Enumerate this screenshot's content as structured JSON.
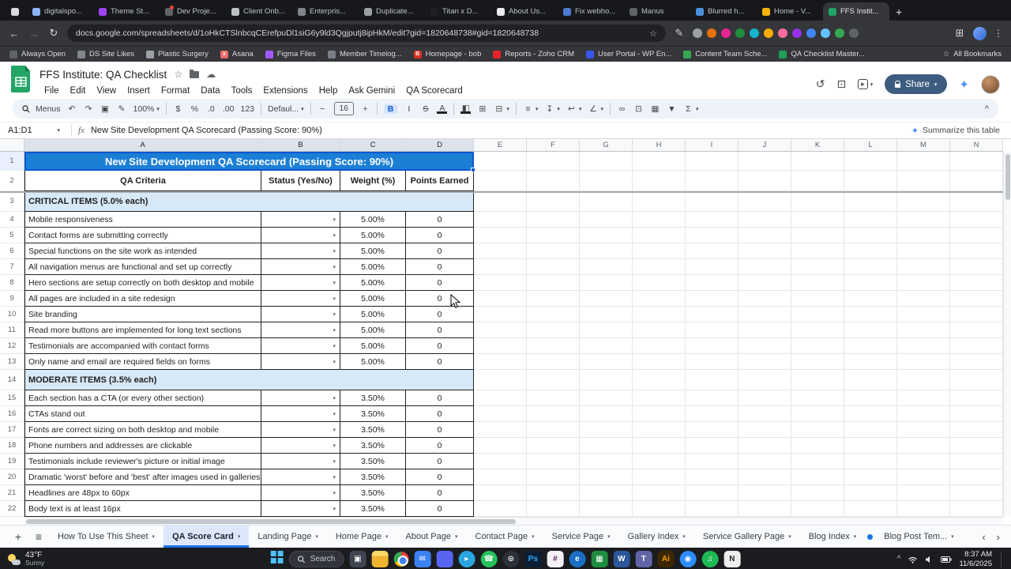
{
  "browser": {
    "tab_strip": {
      "new_tab_label": "+",
      "tabs": [
        {
          "label": "",
          "favicon_color": "#d8dade",
          "pinned": true
        },
        {
          "label": "digitalspo...",
          "favicon_color": "#8ab4f8"
        },
        {
          "label": "Theme St...",
          "favicon_color": "#a142f4"
        },
        {
          "label": "Dev Proje...",
          "favicon_color": "#5f6368",
          "notification": true
        },
        {
          "label": "Client Onb...",
          "favicon_color": "#bdc1c6"
        },
        {
          "label": "Enterpris...",
          "favicon_color": "#80868b"
        },
        {
          "label": "Duplicate...",
          "favicon_color": "#9aa0a6"
        },
        {
          "label": "Titan x D...",
          "favicon_color": "#202124"
        },
        {
          "label": "About Us...",
          "favicon_color": "#e8eaed"
        },
        {
          "label": "Fix webho...",
          "favicon_color": "#4a7bd0"
        },
        {
          "label": "Manus",
          "favicon_color": "#5f6368"
        },
        {
          "label": "Blurred h...",
          "favicon_color": "#4a90d9"
        },
        {
          "label": "Home - V...",
          "favicon_color": "#f4b400"
        },
        {
          "label": "FFS Instit...",
          "favicon_color": "#21a464",
          "active": true
        }
      ]
    },
    "omnibox": {
      "url": "docs.google.com/spreadsheets/d/1oHkCTSlnbcqCErefpuDl1siG6y9ld3Qgjputj8ipHkM/edit?gid=1820648738#gid=1820648738",
      "extension_colors": [
        "#9aa0a6",
        "#e8710a",
        "#e52592",
        "#1e8e3e",
        "#12b5cb",
        "#f9ab00",
        "#ff6d9d",
        "#9334e6",
        "#4285f4",
        "#66c2ff",
        "#34a853",
        "#5f6368"
      ]
    },
    "bookmarks_bar": {
      "items": [
        {
          "label": "Always Open",
          "favicon_color": "#5f6368"
        },
        {
          "label": "DS Site Likes",
          "favicon_color": "#80868b"
        },
        {
          "label": "Plastic Surgery",
          "favicon_color": "#9aa0a6"
        },
        {
          "label": "Asana",
          "favicon_color": "#f06a6a",
          "badge": "x"
        },
        {
          "label": "Figma Files",
          "favicon_color": "#a259ff"
        },
        {
          "label": "Member Timelog...",
          "favicon_color": "#7a7f85"
        },
        {
          "label": "Homepage - bob",
          "favicon_color": "#d93025",
          "favicon_letter": "B"
        },
        {
          "label": "Reports - Zoho CRM",
          "favicon_color": "#e42527"
        },
        {
          "label": "User Portal - WP En...",
          "favicon_color": "#3858e9"
        },
        {
          "label": "Content Team Sche...",
          "favicon_color": "#34a853"
        },
        {
          "label": "QA Checklist Master...",
          "favicon_color": "#1e9e5a"
        }
      ],
      "all_bookmarks_label": "All Bookmarks"
    }
  },
  "sheets": {
    "doc_title": "FFS Institute: QA Checklist",
    "title_icons": [
      {
        "name": "star-icon",
        "glyph": "☆"
      },
      {
        "name": "move-to-folder-icon",
        "glyph": ""
      },
      {
        "name": "cloud-save-status-icon",
        "glyph": "☁"
      }
    ],
    "menu_items": [
      "File",
      "Edit",
      "View",
      "Insert",
      "Format",
      "Data",
      "Tools",
      "Extensions",
      "Help",
      "Ask Gemini",
      "QA Scorecard"
    ],
    "header_icons": [
      {
        "name": "version-history-icon",
        "glyph": "↺"
      },
      {
        "name": "comments-icon",
        "glyph": "⊡"
      },
      {
        "name": "meet-icon",
        "glyph": "▸",
        "dropdown": true
      }
    ],
    "share_label": "Share",
    "toolbar_items": [
      {
        "type": "menus",
        "name": "menus-button",
        "label": "Menus"
      },
      {
        "type": "icon",
        "name": "undo-icon",
        "glyph": "↶"
      },
      {
        "type": "icon",
        "name": "redo-icon",
        "glyph": "↷"
      },
      {
        "type": "icon",
        "name": "print-icon",
        "glyph": "▣"
      },
      {
        "type": "icon",
        "name": "paint-format-icon",
        "glyph": "✎"
      },
      {
        "type": "dropdown",
        "name": "zoom-select",
        "label": "100%"
      },
      {
        "type": "sep"
      },
      {
        "type": "icon",
        "name": "format-currency-icon",
        "glyph": "$"
      },
      {
        "type": "icon",
        "name": "format-percent-icon",
        "glyph": "%"
      },
      {
        "type": "icon",
        "name": "decrease-decimal-icon",
        "glyph": ".0"
      },
      {
        "type": "icon",
        "name": "increase-decimal-icon",
        "glyph": ".00"
      },
      {
        "type": "icon",
        "name": "more-formats-icon",
        "glyph": "123"
      },
      {
        "type": "sep"
      },
      {
        "type": "dropdown",
        "name": "font-family-select",
        "label": "Defaul..."
      },
      {
        "type": "sep"
      },
      {
        "type": "icon",
        "name": "decrease-font-size-icon",
        "glyph": "−"
      },
      {
        "type": "value",
        "name": "font-size-input",
        "label": "16"
      },
      {
        "type": "icon",
        "name": "increase-font-size-icon",
        "glyph": "+"
      },
      {
        "type": "sep"
      },
      {
        "type": "icon",
        "name": "bold-icon",
        "glyph": "B",
        "active": true
      },
      {
        "type": "icon",
        "name": "italic-icon",
        "glyph": "I"
      },
      {
        "type": "icon",
        "name": "strikethrough-icon",
        "glyph": "S",
        "strike": true
      },
      {
        "type": "icon",
        "name": "text-color-icon",
        "glyph": "A",
        "underbar": true
      },
      {
        "type": "sep"
      },
      {
        "type": "icon",
        "name": "fill-color-icon",
        "glyph": "◧",
        "underbar": true
      },
      {
        "type": "icon",
        "name": "borders-icon",
        "glyph": "⊞"
      },
      {
        "type": "icon",
        "name": "merge-cells-icon",
        "glyph": "⊟",
        "dropdown": true
      },
      {
        "type": "sep"
      },
      {
        "type": "icon",
        "name": "horizontal-align-icon",
        "glyph": "≡",
        "dropdown": true
      },
      {
        "type": "icon",
        "name": "vertical-align-icon",
        "glyph": "↧",
        "dropdown": true
      },
      {
        "type": "icon",
        "name": "text-wrap-icon",
        "glyph": "↩",
        "dropdown": true
      },
      {
        "type": "icon",
        "name": "text-rotation-icon",
        "glyph": "∠",
        "dropdown": true
      },
      {
        "type": "sep"
      },
      {
        "type": "icon",
        "name": "insert-link-icon",
        "glyph": "∞"
      },
      {
        "type": "icon",
        "name": "insert-comment-icon",
        "glyph": "⊡"
      },
      {
        "type": "icon",
        "name": "insert-chart-icon",
        "glyph": "▦"
      },
      {
        "type": "icon",
        "name": "create-filter-icon",
        "glyph": "▼"
      },
      {
        "type": "icon",
        "name": "functions-icon",
        "glyph": "Σ",
        "dropdown": true
      }
    ],
    "toolbar_collapse_glyph": "^",
    "name_box_value": "A1:D1",
    "fx_label": "fx",
    "formula_text": "New Site Development QA Scorecard (Passing Score: 90%)",
    "summarize_label": "Summarize this table"
  },
  "grid": {
    "column_letters": [
      "A",
      "B",
      "C",
      "D",
      "E",
      "F",
      "G",
      "H",
      "I",
      "J",
      "K",
      "L",
      "M",
      "N"
    ],
    "selected_columns": [
      "A",
      "B",
      "C",
      "D"
    ],
    "selected_row_number": 1,
    "rows": [
      {
        "n": 1,
        "type": "title",
        "text": "New Site Development QA Scorecard (Passing Score: 90%)"
      },
      {
        "n": 2,
        "type": "header",
        "cells": [
          "QA Criteria",
          "Status (Yes/No)",
          "Weight (%)",
          "Points Earned"
        ]
      },
      {
        "n": 3,
        "type": "section",
        "text": "CRITICAL ITEMS (5.0% each)"
      },
      {
        "n": 4,
        "type": "item",
        "criteria": "Mobile responsiveness",
        "weight": "5.00%",
        "points": "0"
      },
      {
        "n": 5,
        "type": "item",
        "criteria": "Contact forms are submitting correctly",
        "weight": "5.00%",
        "points": "0"
      },
      {
        "n": 6,
        "type": "item",
        "criteria": "Special functions on the site work as intended",
        "weight": "5.00%",
        "points": "0"
      },
      {
        "n": 7,
        "type": "item",
        "criteria": "All navigation menus are functional and set up correctly",
        "weight": "5.00%",
        "points": "0"
      },
      {
        "n": 8,
        "type": "item",
        "criteria": "Hero sections are setup correctly on both desktop and mobile",
        "weight": "5.00%",
        "points": "0"
      },
      {
        "n": 9,
        "type": "item",
        "criteria": "All pages are included in a site redesign",
        "weight": "5.00%",
        "points": "0"
      },
      {
        "n": 10,
        "type": "item",
        "criteria": "Site branding",
        "weight": "5.00%",
        "points": "0"
      },
      {
        "n": 11,
        "type": "item",
        "criteria": "Read more buttons are implemented for long text sections",
        "weight": "5.00%",
        "points": "0"
      },
      {
        "n": 12,
        "type": "item",
        "criteria": "Testimonials are accompanied with contact forms",
        "weight": "5.00%",
        "points": "0"
      },
      {
        "n": 13,
        "type": "item",
        "criteria": "Only name and email are required fields on forms",
        "weight": "5.00%",
        "points": "0"
      },
      {
        "n": 14,
        "type": "section",
        "text": "MODERATE ITEMS (3.5% each)"
      },
      {
        "n": 15,
        "type": "item",
        "criteria": "Each section has a CTA (or every other section)",
        "weight": "3.50%",
        "points": "0"
      },
      {
        "n": 16,
        "type": "item",
        "criteria": "CTAs stand out",
        "weight": "3.50%",
        "points": "0"
      },
      {
        "n": 17,
        "type": "item",
        "criteria": "Fonts are correct sizing on both desktop and mobile",
        "weight": "3.50%",
        "points": "0"
      },
      {
        "n": 18,
        "type": "item",
        "criteria": "Phone numbers and addresses are clickable",
        "weight": "3.50%",
        "points": "0"
      },
      {
        "n": 19,
        "type": "item",
        "criteria": "Testimonials include reviewer's picture or initial image",
        "weight": "3.50%",
        "points": "0"
      },
      {
        "n": 20,
        "type": "item",
        "criteria": "Dramatic 'worst' before and 'best' after images used in galleries",
        "weight": "3.50%",
        "points": "0"
      },
      {
        "n": 21,
        "type": "item",
        "criteria": "Headlines are 48px to 60px",
        "weight": "3.50%",
        "points": "0"
      },
      {
        "n": 22,
        "type": "item",
        "criteria": "Body text is at least 16px",
        "weight": "3.50%",
        "points": "0"
      }
    ]
  },
  "sheet_tab_bar": {
    "add_sheet_glyph": "+",
    "all_sheets_glyph": "≡",
    "tabs": [
      {
        "label": "How To Use This Sheet"
      },
      {
        "label": "QA Score Card",
        "active": true
      },
      {
        "label": "Landing Page"
      },
      {
        "label": "Home Page"
      },
      {
        "label": "About Page"
      },
      {
        "label": "Contact Page"
      },
      {
        "label": "Service Page"
      },
      {
        "label": "Gallery Index"
      },
      {
        "label": "Service Gallery Page"
      },
      {
        "label": "Blog Index",
        "notification": true
      },
      {
        "label": "Blog Post Tem..."
      }
    ],
    "scroll_left_glyph": "‹",
    "scroll_right_glyph": "›"
  },
  "taskbar": {
    "weather": {
      "temp": "43°F",
      "condition": "Sunny"
    },
    "search_label": "Search",
    "clock": {
      "time": "8:37 AM",
      "date": "11/6/2025"
    },
    "apps": [
      {
        "name": "task-view",
        "color": "#3f4550",
        "glyph": "▣"
      },
      {
        "name": "file-explorer",
        "color": "#f3b73a",
        "glyph": ""
      },
      {
        "name": "chrome",
        "special": "chrome"
      },
      {
        "name": "mail",
        "color": "#3b82f6",
        "glyph": "✉"
      },
      {
        "name": "discord",
        "color": "#5865f2",
        "glyph": ""
      },
      {
        "name": "telegram",
        "color": "#2aa5e0",
        "glyph": "▸",
        "round": true
      },
      {
        "name": "whatsapp",
        "color": "#27c25b",
        "glyph": "☎",
        "round": true
      },
      {
        "name": "github",
        "color": "#2b3137",
        "glyph": "⊙",
        "round": true
      },
      {
        "name": "photoshop",
        "color": "#0a1f33",
        "glyph": "Ps",
        "fg": "#31a8ff"
      },
      {
        "name": "slack",
        "color": "#f4f0f4",
        "glyph": "#",
        "fg": "#611f69"
      },
      {
        "name": "edge",
        "color": "#1a6fc4",
        "glyph": "e",
        "round": true
      },
      {
        "name": "sheets",
        "color": "#1e8e3e",
        "glyph": "▦"
      },
      {
        "name": "word",
        "color": "#2b579a",
        "glyph": "W"
      },
      {
        "name": "teams",
        "color": "#6264a7",
        "glyph": "T"
      },
      {
        "name": "illustrator",
        "color": "#3c2800",
        "glyph": "Ai",
        "fg": "#ff9a00"
      },
      {
        "name": "zoom",
        "color": "#2d8cff",
        "glyph": "◉",
        "round": true
      },
      {
        "name": "spotify",
        "color": "#1db954",
        "glyph": "♫",
        "round": true
      },
      {
        "name": "notion",
        "color": "#ededed",
        "glyph": "N",
        "fg": "#1f1f1f"
      }
    ]
  }
}
